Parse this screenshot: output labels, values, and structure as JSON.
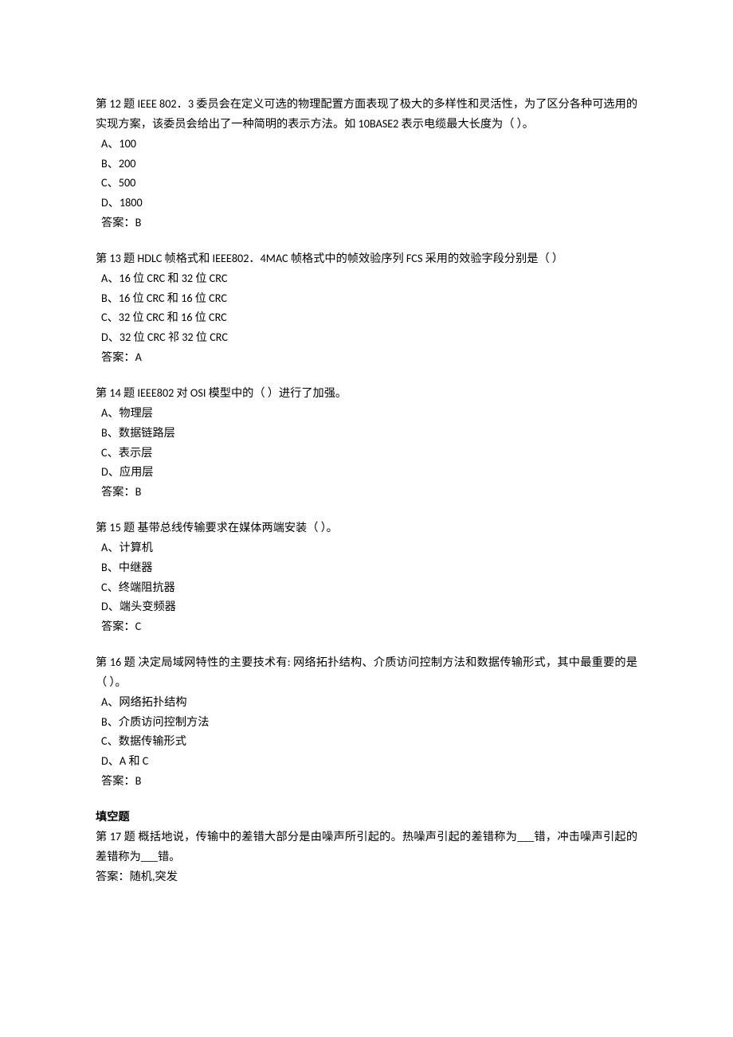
{
  "questions": [
    {
      "number_label": "第 12 题",
      "stem": "IEEE 802．3 委员会在定义可选的物理配置方面表现了极大的多样性和灵活性，为了区分各种可选用的实现方案，该委员会给出了一种简明的表示方法。如 10BASE2 表示电缆最大长度为（  ）。",
      "options": [
        "A、100",
        "B、200",
        "C、500",
        "D、1800"
      ],
      "answer": "答案：B"
    },
    {
      "number_label": "第 13 题",
      "stem": "HDLC 帧格式和 IEEE802．4MAC 帧格式中的帧效验序列 FCS 采用的效验字段分别是（  ）",
      "options": [
        "A、16 位 CRC 和 32 位 CRC",
        "B、16 位 CRC 和 16 位 CRC",
        "C、32 位 CRC 和 16 位 CRC",
        "D、32 位 CRC 祁 32 位 CRC"
      ],
      "answer": "答案：A"
    },
    {
      "number_label": "第 14 题",
      "stem": "IEEE802 对 OSI 模型中的（  ）进行了加强。",
      "options": [
        "A、物理层",
        "B、数据链路层",
        "C、表示层",
        "D、应用层"
      ],
      "answer": "答案：B"
    },
    {
      "number_label": "第 15 题",
      "stem": "基带总线传输要求在媒体两端安装（  ）。",
      "options": [
        "A、计算机",
        "B、中继器",
        "C、终端阻抗器",
        "D、端头变频器"
      ],
      "answer": "答案：C"
    },
    {
      "number_label": "第 16 题",
      "stem": "决定局域网特性的主要技术有: 网络拓扑结构、介质访问控制方法和数据传输形式，其中最重要的是（  ）。",
      "options": [
        "A、网络拓扑结构",
        "B、介质访问控制方法",
        "C、数据传输形式",
        "D、A 和 C"
      ],
      "answer": "答案：B"
    }
  ],
  "section_heading": "填空题",
  "fill": {
    "number_label": "第 17 题",
    "stem": "概括地说，传输中的差错大部分是由噪声所引起的。热噪声引起的差错称为___错，冲击噪声引起的差错称为___错。",
    "answer": "答案：随机,突发"
  }
}
